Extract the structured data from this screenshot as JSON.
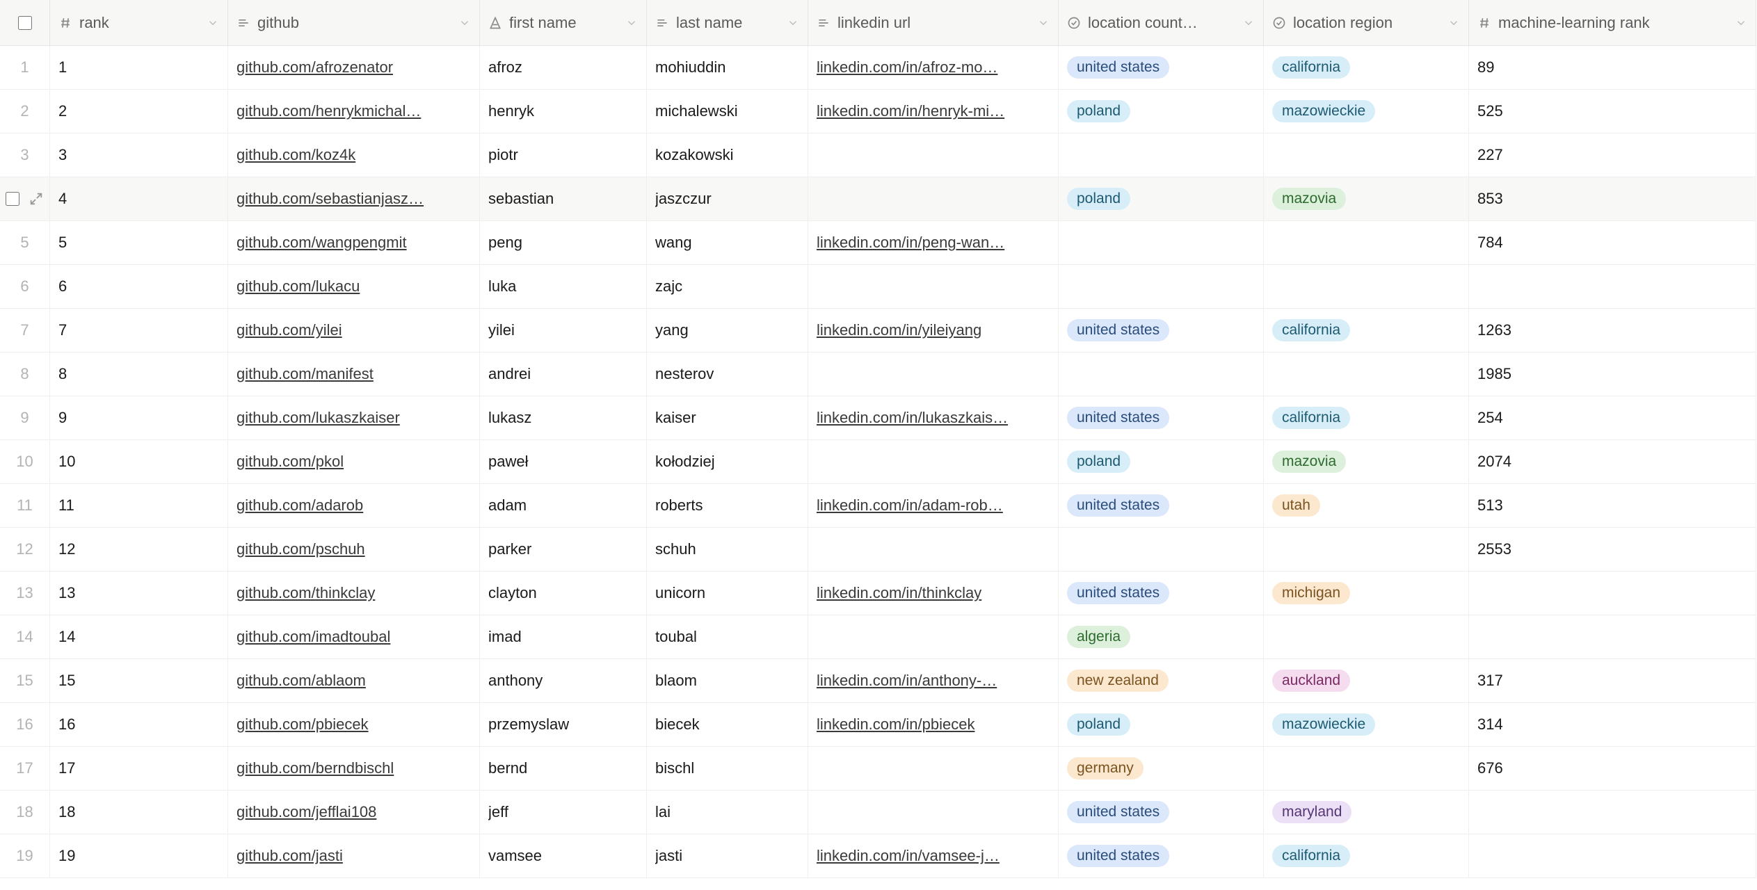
{
  "columns": {
    "rank": "rank",
    "github": "github",
    "first_name": "first name",
    "last_name": "last name",
    "linkedin": "linkedin url",
    "loc_country": "location count…",
    "loc_region": "location region",
    "ml_rank": "machine-learning rank"
  },
  "pill_colors": {
    "united states": "blue",
    "poland": "cyan",
    "algeria": "green",
    "new zealand": "orange",
    "germany": "orange",
    "california": "cyan",
    "mazowieckie": "cyan",
    "mazovia": "green",
    "utah": "orange",
    "michigan": "orange",
    "auckland": "pink",
    "maryland": "violet"
  },
  "rows": [
    {
      "n": "1",
      "rank": "1",
      "github": "github.com/afrozenator",
      "first": "afroz",
      "last": "mohiuddin",
      "linkedin": "linkedin.com/in/afroz-mo…",
      "country": "united states",
      "region": "california",
      "ml": "89"
    },
    {
      "n": "2",
      "rank": "2",
      "github": "github.com/henrykmichal…",
      "first": "henryk",
      "last": "michalewski",
      "linkedin": "linkedin.com/in/henryk-mi…",
      "country": "poland",
      "region": "mazowieckie",
      "ml": "525"
    },
    {
      "n": "3",
      "rank": "3",
      "github": "github.com/koz4k",
      "first": "piotr",
      "last": "kozakowski",
      "linkedin": "",
      "country": "",
      "region": "",
      "ml": "227"
    },
    {
      "n": "4",
      "rank": "4",
      "github": "github.com/sebastianjasz…",
      "first": "sebastian",
      "last": "jaszczur",
      "linkedin": "",
      "country": "poland",
      "region": "mazovia",
      "ml": "853",
      "hovered": true
    },
    {
      "n": "5",
      "rank": "5",
      "github": "github.com/wangpengmit",
      "first": "peng",
      "last": "wang",
      "linkedin": "linkedin.com/in/peng-wan…",
      "country": "",
      "region": "",
      "ml": "784"
    },
    {
      "n": "6",
      "rank": "6",
      "github": "github.com/lukacu",
      "first": "luka",
      "last": "zajc",
      "linkedin": "",
      "country": "",
      "region": "",
      "ml": ""
    },
    {
      "n": "7",
      "rank": "7",
      "github": "github.com/yilei",
      "first": "yilei",
      "last": "yang",
      "linkedin": "linkedin.com/in/yileiyang",
      "country": "united states",
      "region": "california",
      "ml": "1263"
    },
    {
      "n": "8",
      "rank": "8",
      "github": "github.com/manifest",
      "first": "andrei",
      "last": "nesterov",
      "linkedin": "",
      "country": "",
      "region": "",
      "ml": "1985"
    },
    {
      "n": "9",
      "rank": "9",
      "github": "github.com/lukaszkaiser",
      "first": "lukasz",
      "last": "kaiser",
      "linkedin": "linkedin.com/in/lukaszkais…",
      "country": "united states",
      "region": "california",
      "ml": "254"
    },
    {
      "n": "10",
      "rank": "10",
      "github": "github.com/pkol",
      "first": "paweł",
      "last": "kołodziej",
      "linkedin": "",
      "country": "poland",
      "region": "mazovia",
      "ml": "2074"
    },
    {
      "n": "11",
      "rank": "11",
      "github": "github.com/adarob",
      "first": "adam",
      "last": "roberts",
      "linkedin": "linkedin.com/in/adam-rob…",
      "country": "united states",
      "region": "utah",
      "ml": "513"
    },
    {
      "n": "12",
      "rank": "12",
      "github": "github.com/pschuh",
      "first": "parker",
      "last": "schuh",
      "linkedin": "",
      "country": "",
      "region": "",
      "ml": "2553"
    },
    {
      "n": "13",
      "rank": "13",
      "github": "github.com/thinkclay",
      "first": "clayton",
      "last": "unicorn",
      "linkedin": "linkedin.com/in/thinkclay",
      "country": "united states",
      "region": "michigan",
      "ml": ""
    },
    {
      "n": "14",
      "rank": "14",
      "github": "github.com/imadtoubal",
      "first": "imad",
      "last": "toubal",
      "linkedin": "",
      "country": "algeria",
      "region": "",
      "ml": ""
    },
    {
      "n": "15",
      "rank": "15",
      "github": "github.com/ablaom",
      "first": "anthony",
      "last": "blaom",
      "linkedin": "linkedin.com/in/anthony-…",
      "country": "new zealand",
      "region": "auckland",
      "ml": "317"
    },
    {
      "n": "16",
      "rank": "16",
      "github": "github.com/pbiecek",
      "first": "przemyslaw",
      "last": "biecek",
      "linkedin": "linkedin.com/in/pbiecek",
      "country": "poland",
      "region": "mazowieckie",
      "ml": "314"
    },
    {
      "n": "17",
      "rank": "17",
      "github": "github.com/berndbischl",
      "first": "bernd",
      "last": "bischl",
      "linkedin": "",
      "country": "germany",
      "region": "",
      "ml": "676"
    },
    {
      "n": "18",
      "rank": "18",
      "github": "github.com/jefflai108",
      "first": "jeff",
      "last": "lai",
      "linkedin": "",
      "country": "united states",
      "region": "maryland",
      "ml": ""
    },
    {
      "n": "19",
      "rank": "19",
      "github": "github.com/jasti",
      "first": "vamsee",
      "last": "jasti",
      "linkedin": "linkedin.com/in/vamsee-j…",
      "country": "united states",
      "region": "california",
      "ml": ""
    }
  ]
}
